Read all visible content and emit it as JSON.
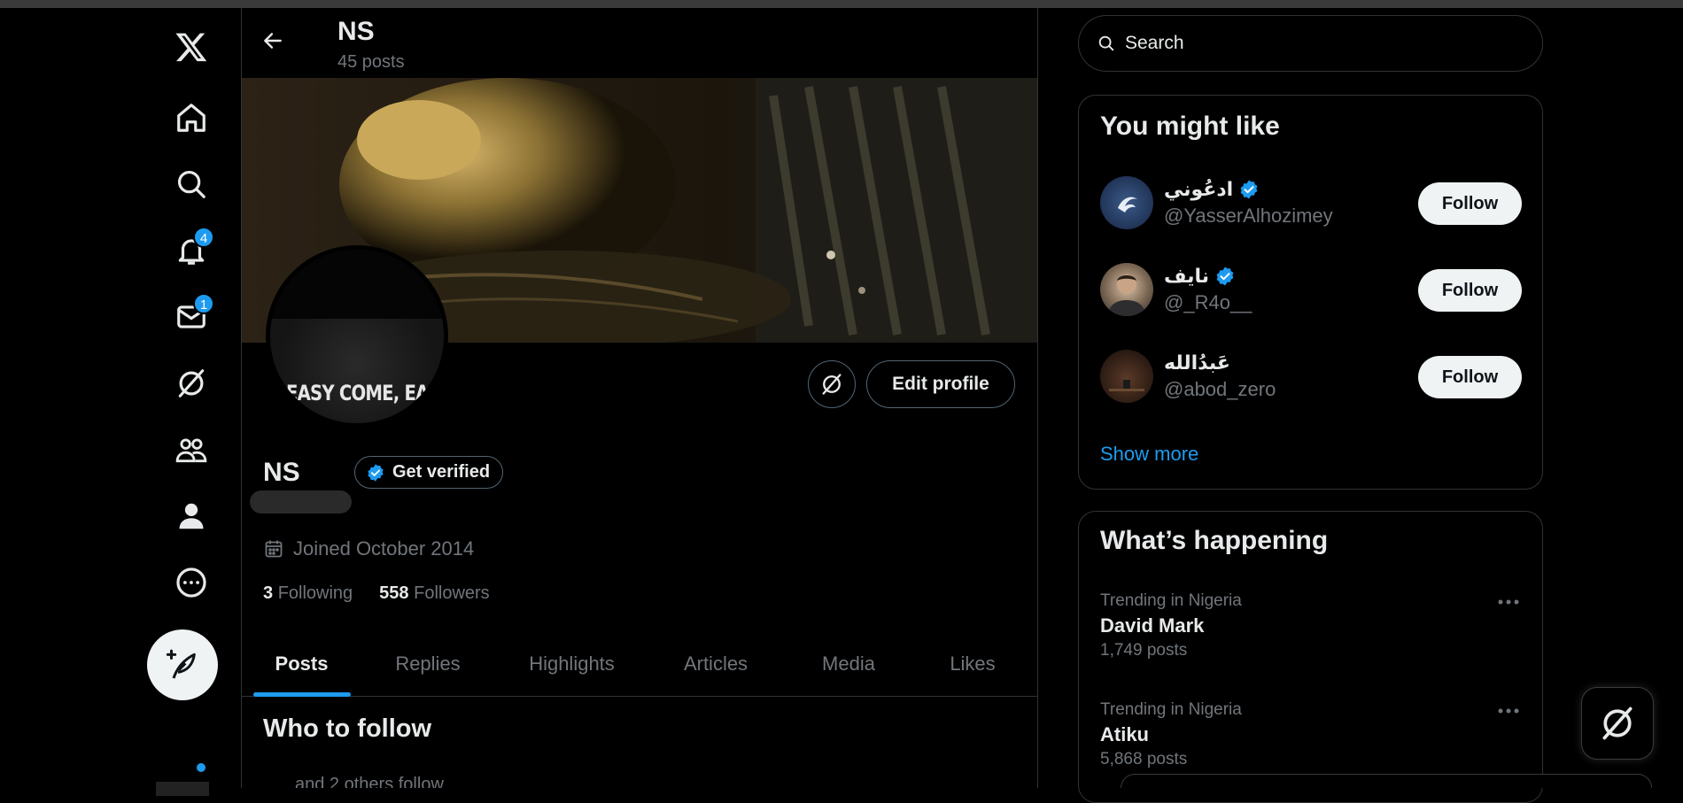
{
  "nav": {
    "items": [
      {
        "name": "x-logo-icon"
      },
      {
        "name": "home-icon"
      },
      {
        "name": "explore-icon"
      },
      {
        "name": "notifications-icon",
        "badge": "4"
      },
      {
        "name": "messages-icon",
        "badge": "1"
      },
      {
        "name": "grok-icon"
      },
      {
        "name": "communities-icon"
      },
      {
        "name": "profile-icon"
      },
      {
        "name": "more-icon"
      }
    ],
    "compose_icon": "compose-feather-icon"
  },
  "header": {
    "name": "NS",
    "post_count": "45 posts"
  },
  "profile": {
    "avatar_text": "EASY COME, EASY GO",
    "name": "NS",
    "get_verified": "Get verified",
    "edit_profile": "Edit profile",
    "joined": "Joined October 2014",
    "following_count": "3",
    "following_label": "Following",
    "followers_count": "558",
    "followers_label": "Followers"
  },
  "tabs": [
    "Posts",
    "Replies",
    "Highlights",
    "Articles",
    "Media",
    "Likes"
  ],
  "active_tab": "Posts",
  "who_to_follow": {
    "title": "Who to follow",
    "peek": "and 2 others follow"
  },
  "search": {
    "placeholder": "Search"
  },
  "you_might_like": {
    "title": "You might like",
    "users": [
      {
        "name": "ادعُوني",
        "handle": "@YasserAlhozimey",
        "verified": true,
        "button": "Follow"
      },
      {
        "name": "نايف",
        "handle": "@_R4o__",
        "verified": true,
        "button": "Follow"
      },
      {
        "name": "عَبدُالله",
        "handle": "@abod_zero",
        "verified": false,
        "button": "Follow"
      }
    ],
    "show_more": "Show more"
  },
  "whats_happening": {
    "title": "What’s happening",
    "trends": [
      {
        "context": "Trending in Nigeria",
        "topic": "David Mark",
        "posts": "1,749 posts"
      },
      {
        "context": "Trending in Nigeria",
        "topic": "Atiku",
        "posts": "5,868 posts"
      }
    ]
  },
  "colors": {
    "accent": "#1d9bf0",
    "background": "#000000",
    "border": "#2f3336",
    "muted_text": "#71767b"
  }
}
